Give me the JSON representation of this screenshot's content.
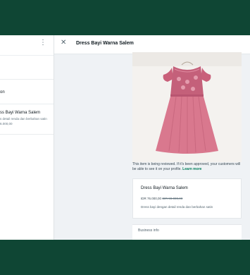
{
  "sidebar": {
    "menu_icon": "more-vertical-icon",
    "partial_item_label": "on",
    "product_snippet": {
      "title": "ss Bayi Warna Salem",
      "description": "s detail renda dan berbahan satin",
      "price": "6.000,00"
    }
  },
  "panel": {
    "close_icon": "close-icon",
    "title": "Dress Bayi Warna Salem",
    "notice": "This item is being reviewed. If it's been approved, your customers will be able to see it on your profile.",
    "notice_link": "Learn more",
    "product": {
      "name": "Dress Bayi Warna Salem",
      "price": "IDR 76.000,00",
      "old_price": "IDR 90.000,00",
      "description": "Dress bayi dengan detail renda dan berbahan satin"
    },
    "business_info_label": "Business info"
  },
  "colors": {
    "background": "#0f4634",
    "accent": "#027e5a",
    "dress_pink": "#d9788e"
  }
}
